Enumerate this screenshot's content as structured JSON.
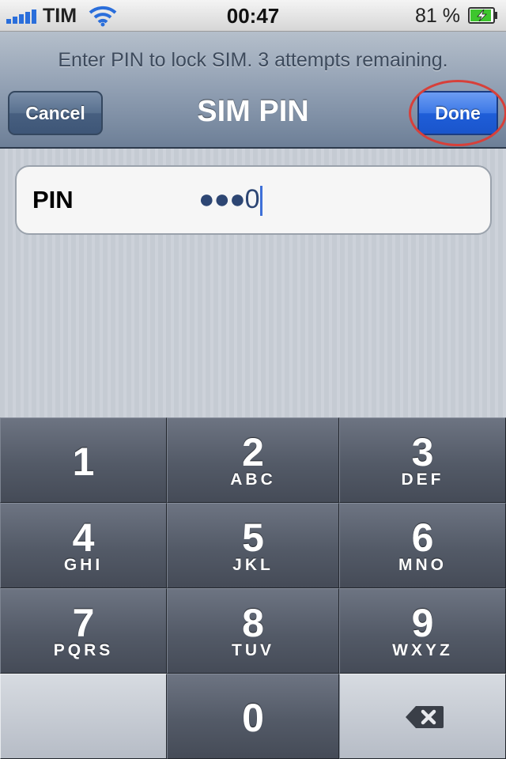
{
  "status_bar": {
    "carrier": "TIM",
    "time": "00:47",
    "battery_percent": "81 %",
    "icons": [
      "signal-bars-icon",
      "wifi-icon",
      "battery-charging-icon"
    ]
  },
  "nav": {
    "prompt": "Enter PIN to lock SIM. 3 attempts remaining.",
    "title": "SIM PIN",
    "cancel_label": "Cancel",
    "done_label": "Done"
  },
  "pin_field": {
    "label": "PIN",
    "value": "●●●0"
  },
  "keypad": {
    "keys": [
      {
        "digit": "1",
        "letters": ""
      },
      {
        "digit": "2",
        "letters": "ABC"
      },
      {
        "digit": "3",
        "letters": "DEF"
      },
      {
        "digit": "4",
        "letters": "GHI"
      },
      {
        "digit": "5",
        "letters": "JKL"
      },
      {
        "digit": "6",
        "letters": "MNO"
      },
      {
        "digit": "7",
        "letters": "PQRS"
      },
      {
        "digit": "8",
        "letters": "TUV"
      },
      {
        "digit": "9",
        "letters": "WXYZ"
      },
      {
        "digit": "0",
        "letters": ""
      }
    ],
    "delete_icon": "backspace-icon"
  },
  "colors": {
    "done_button": "#1f5ed8",
    "highlight_ring": "#d7403a",
    "signal_bars": "#2a6edb",
    "battery_fill": "#3ec62e"
  }
}
